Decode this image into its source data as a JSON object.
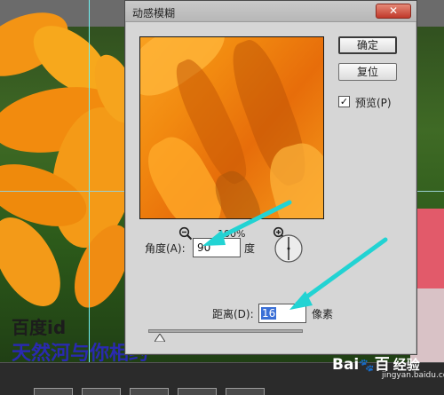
{
  "dialog": {
    "title": "动感模糊",
    "close_icon": "close-icon",
    "ok_label": "确定",
    "reset_label": "复位",
    "preview_checkbox": {
      "label": "预览(P)",
      "checked": true,
      "check_glyph": "✓"
    },
    "zoom": {
      "level": "100%",
      "zoom_out_icon": "zoom-out-icon",
      "zoom_in_icon": "zoom-in-icon"
    },
    "angle": {
      "label": "角度(A):",
      "value": "90",
      "unit": "度",
      "dial_icon": "angle-dial-icon"
    },
    "distance": {
      "label": "距离(D):",
      "value": "16",
      "unit": "像素"
    }
  },
  "watermark": {
    "line1": "百度id",
    "line2": "天然河与你相约"
  },
  "brand": {
    "logo": "Bai",
    "logo_tail": "百",
    "jingyan": "经验",
    "url": "jingyan.baidu.com"
  },
  "colors": {
    "annotation_arrow": "#22d3d3",
    "guide_line": "#6ff2f2",
    "close_button": "#c0392b",
    "selection_highlight": "#3a6fd6"
  }
}
